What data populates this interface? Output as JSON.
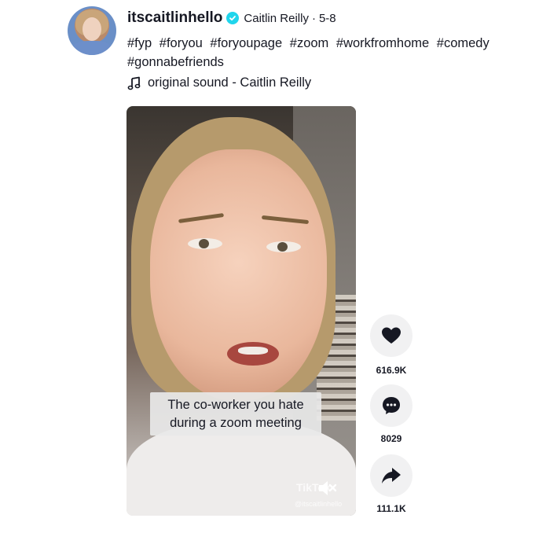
{
  "author": {
    "username": "itscaitlinhello",
    "nickname": "Caitlin Reilly",
    "separator": "·",
    "date": "5-8",
    "verified": true
  },
  "description": {
    "hashtags": [
      "#fyp",
      "#foryou",
      "#foryoupage",
      "#zoom",
      "#workfromhome",
      "#comedy",
      "#gonnabefriends"
    ]
  },
  "music": {
    "label": "original sound - Caitlin Reilly",
    "icon": "music-note-icon"
  },
  "video": {
    "caption": "The co-worker you hate during a zoom meeting",
    "watermark": "TikTok",
    "watermark_user": "@itscaitlinhello",
    "muted": true
  },
  "actions": {
    "like_count": "616.9K",
    "comment_count": "8029",
    "share_count": "111.1K"
  },
  "colors": {
    "verified": "#20d5ec",
    "text": "#161823",
    "action_bg": "#f1f1f2"
  }
}
